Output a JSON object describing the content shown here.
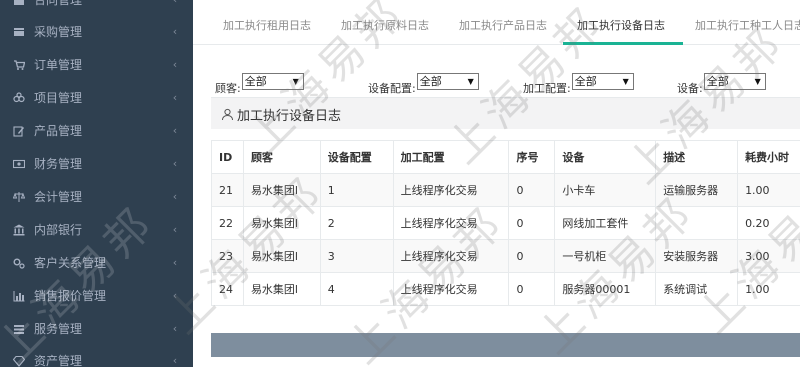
{
  "sidebar": {
    "items": [
      {
        "label": "合同管理",
        "icon": "contract-icon"
      },
      {
        "label": "采购管理",
        "icon": "purchase-icon"
      },
      {
        "label": "订单管理",
        "icon": "cart-icon"
      },
      {
        "label": "项目管理",
        "icon": "project-icon"
      },
      {
        "label": "产品管理",
        "icon": "edit-icon"
      },
      {
        "label": "财务管理",
        "icon": "finance-icon"
      },
      {
        "label": "会计管理",
        "icon": "scale-icon"
      },
      {
        "label": "内部银行",
        "icon": "bank-icon"
      },
      {
        "label": "客户关系管理",
        "icon": "gears-icon"
      },
      {
        "label": "销售报价管理",
        "icon": "bar-chart-icon"
      },
      {
        "label": "服务管理",
        "icon": "list-icon"
      },
      {
        "label": "资产管理",
        "icon": "diamond-icon"
      }
    ],
    "chevron": "‹"
  },
  "tabs": [
    {
      "label": "加工执行租用日志"
    },
    {
      "label": "加工执行原料日志"
    },
    {
      "label": "加工执行产品日志"
    },
    {
      "label": "加工执行设备日志",
      "active": true
    },
    {
      "label": "加工执行工种工人日志"
    }
  ],
  "filters": [
    {
      "label": "顾客:",
      "value": "全部"
    },
    {
      "label": "设备配置:",
      "value": "全部"
    },
    {
      "label": "加工配置:",
      "value": "全部"
    },
    {
      "label": "设备:",
      "value": "全部"
    }
  ],
  "panel": {
    "title": "加工执行设备日志"
  },
  "table": {
    "headers": [
      "ID",
      "顾客",
      "设备配置",
      "加工配置",
      "序号",
      "设备",
      "描述",
      "耗费小时"
    ],
    "rows": [
      [
        "21",
        "易水集团l",
        "1",
        "上线程序化交易",
        "0",
        "小卡车",
        "运输服务器",
        "1.00"
      ],
      [
        "22",
        "易水集团l",
        "2",
        "上线程序化交易",
        "0",
        "网线加工套件",
        "",
        "0.20"
      ],
      [
        "23",
        "易水集团l",
        "3",
        "上线程序化交易",
        "0",
        "一号机柜",
        "安装服务器",
        "3.00"
      ],
      [
        "24",
        "易水集团l",
        "4",
        "上线程序化交易",
        "0",
        "服务器00001",
        "系统调试",
        "1.00"
      ]
    ]
  },
  "watermark": {
    "text": "上海易邦"
  },
  "colors": {
    "sidebar_bg": "#2f4050",
    "accent": "#1ab394",
    "bottom_bar": "#7e8e9e"
  }
}
